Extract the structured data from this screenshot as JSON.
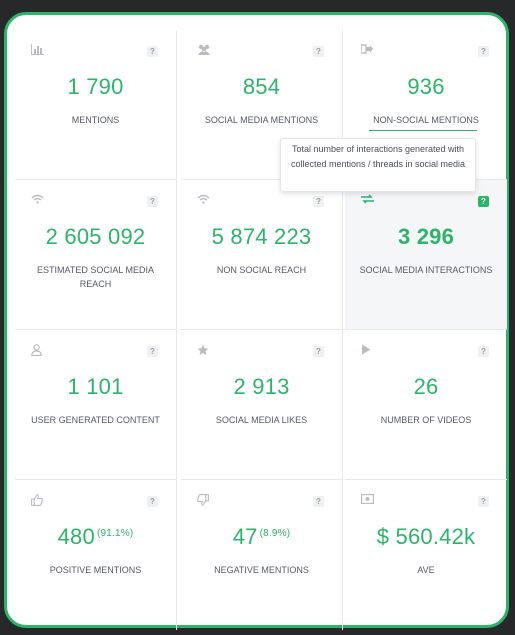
{
  "accent_color": "#2db36a",
  "help_label": "?",
  "tooltip": {
    "text": "Total number of interactions generated with collected mentions / threads in social media"
  },
  "cells": [
    {
      "icon": "bar-chart-icon",
      "value": "1 790",
      "label": "MENTIONS"
    },
    {
      "icon": "users-icon",
      "value": "854",
      "label": "SOCIAL MEDIA MENTIONS"
    },
    {
      "icon": "sign-out-icon",
      "value": "936",
      "label": "NON-SOCIAL MENTIONS"
    },
    {
      "icon": "wifi-icon",
      "value": "2 605 092",
      "label": "ESTIMATED SOCIAL MEDIA REACH"
    },
    {
      "icon": "wifi-icon",
      "value": "5 874 223",
      "label": "NON SOCIAL REACH"
    },
    {
      "icon": "exchange-icon",
      "value": "3 296",
      "label": "SOCIAL MEDIA INTERACTIONS"
    },
    {
      "icon": "user-icon",
      "value": "1 101",
      "label": "USER GENERATED CONTENT"
    },
    {
      "icon": "star-icon",
      "value": "2 913",
      "label": "SOCIAL MEDIA LIKES"
    },
    {
      "icon": "play-icon",
      "value": "26",
      "label": "NUMBER OF VIDEOS"
    },
    {
      "icon": "thumbs-up-icon",
      "value": "480",
      "pct": "(91.1%)",
      "label": "POSITIVE MENTIONS"
    },
    {
      "icon": "thumbs-down-icon",
      "value": "47",
      "pct": "(8.9%)",
      "label": "NEGATIVE MENTIONS"
    },
    {
      "icon": "money-icon",
      "value": "$ 560.42k",
      "label": "AVE"
    }
  ]
}
